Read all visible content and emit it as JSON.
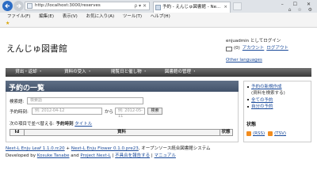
{
  "browser": {
    "url": "http://localhost:3000/reserves",
    "tab_title": "予約 - えんじゅ図書館 - Ne...",
    "tab_close": "×",
    "window_buttons": "– ☐ ✕",
    "tool_icons": "⌂ ☆ ⚙",
    "addr_tools": "ρ ▾ ✕",
    "menu": [
      "ファイル(F)",
      "編集(E)",
      "表示(V)",
      "お気に入り(A)",
      "ツール(T)",
      "ヘルプ(H)"
    ],
    "fav_star": "★"
  },
  "site": {
    "logo": "えんじゅ図書館"
  },
  "user": {
    "login_text": "enjuadmin としてログイン",
    "mail_count": "(0)",
    "account": "アカウント",
    "logout": "ログアウト",
    "other_languages": "Other languages"
  },
  "nav": [
    "貸出・返却 ・",
    "資料の受入 ・",
    "閲覧日と催し物 ・",
    "図書館の管理 ・"
  ],
  "panel": {
    "title": "予約の一覧",
    "search_label": "検索語:",
    "search_placeholder": "検索語",
    "date_label": "予約時刻:",
    "date_from": "例: 2012-04-12",
    "date_sep": "から",
    "date_to": "例: 2012-05-11",
    "search_button": "検索",
    "sort_prefix": "次の項目で並べ替える:",
    "sort_current": "予約時刻",
    "sort_title": "タイトル",
    "table_headers": [
      "Id",
      "資料",
      "状態"
    ]
  },
  "sidebar": {
    "new_reserve": "予約の新規作成",
    "new_reserve_sub": "(資料を検索する)",
    "all_reserves": "全ての予約",
    "my_reserves": "自分の予約",
    "feed_title": "状態",
    "rss": "(RSS)",
    "tsv": "(TSV)"
  },
  "footer": {
    "leaf": "Next-L Enju Leaf 1.1.0.rc20",
    "plus": " + ",
    "flower": "Next-L Enju Flower 0.1.0.pre23",
    "desc": ", オープンソース統合図書館システム",
    "dev_by": "Developed by ",
    "dev1": "Kosuke Tanabe",
    "and": " and ",
    "dev2": "Project Next-L",
    "sep": " | ",
    "report": "不具合を報告する",
    "manual": "マニュアル"
  }
}
